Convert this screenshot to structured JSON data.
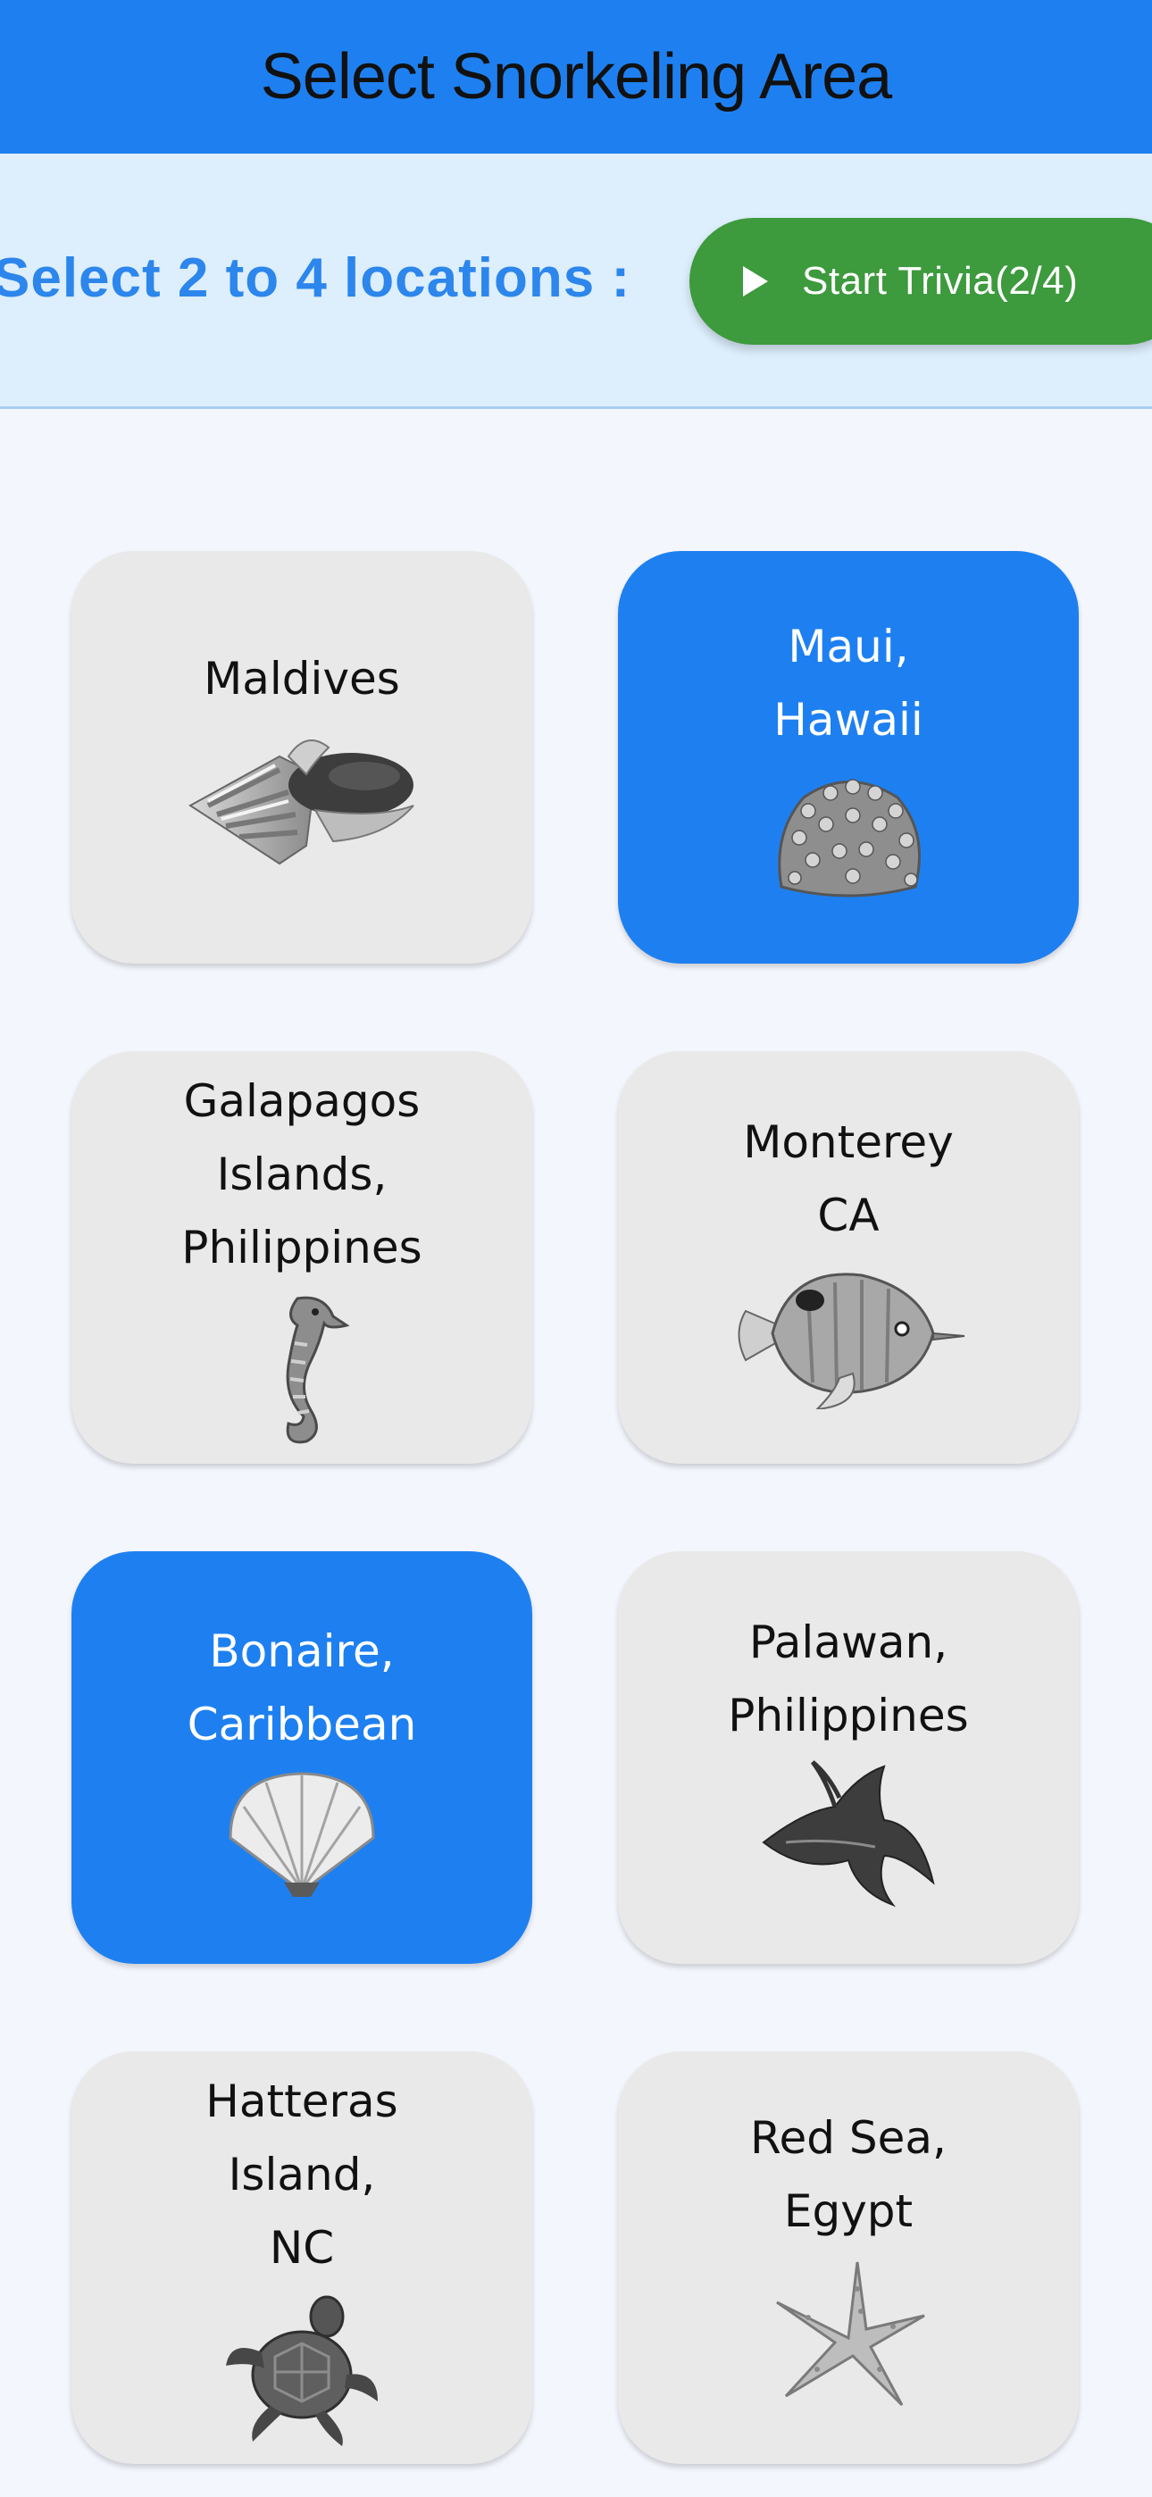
{
  "header": {
    "title": "Select Snorkeling Area"
  },
  "toolbar": {
    "prompt": "Select 2 to 4 locations :",
    "start_label": "Start Trivia(2/4)",
    "start_icon": "play-icon",
    "start_color": "#3d9a3d"
  },
  "colors": {
    "accent": "#1e80f0",
    "tile": "#e9e9e9",
    "subbar": "#ddeefc"
  },
  "locations": [
    {
      "label": "Maldives",
      "icon": "conch-shell-icon",
      "selected": false
    },
    {
      "label": "Maui,\nHawaii",
      "icon": "coral-icon",
      "selected": true
    },
    {
      "label": "Galapagos\nIslands,\nPhilippines",
      "icon": "seahorse-icon",
      "selected": false
    },
    {
      "label": "Monterey\nCA",
      "icon": "butterflyfish-icon",
      "selected": false
    },
    {
      "label": "Bonaire,\nCaribbean",
      "icon": "scallop-shell-icon",
      "selected": true
    },
    {
      "label": "Palawan,\nPhilippines",
      "icon": "manta-ray-icon",
      "selected": false
    },
    {
      "label": "Hatteras\nIsland,\nNC",
      "icon": "sea-turtle-icon",
      "selected": false
    },
    {
      "label": "Red Sea,\nEgypt",
      "icon": "starfish-icon",
      "selected": false
    }
  ]
}
